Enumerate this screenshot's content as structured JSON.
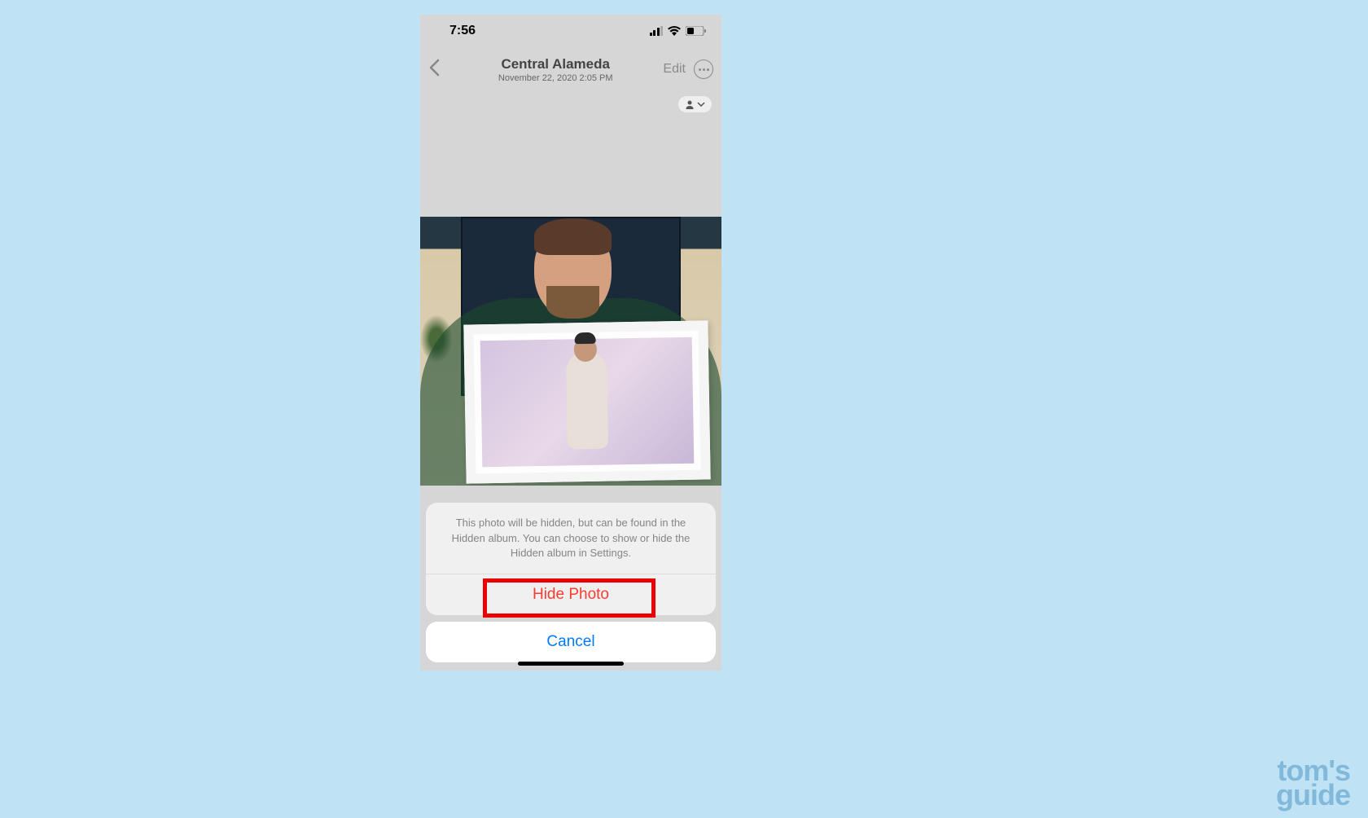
{
  "status": {
    "time": "7:56"
  },
  "header": {
    "title": "Central Alameda",
    "subtitle": "November 22, 2020  2:05 PM",
    "edit_label": "Edit"
  },
  "sheet": {
    "message": "This photo will be hidden, but can be found in the Hidden album. You can choose to show or hide the Hidden album in Settings.",
    "hide_label": "Hide Photo",
    "cancel_label": "Cancel"
  },
  "watermark": {
    "line1": "tom's",
    "line2": "guide"
  }
}
